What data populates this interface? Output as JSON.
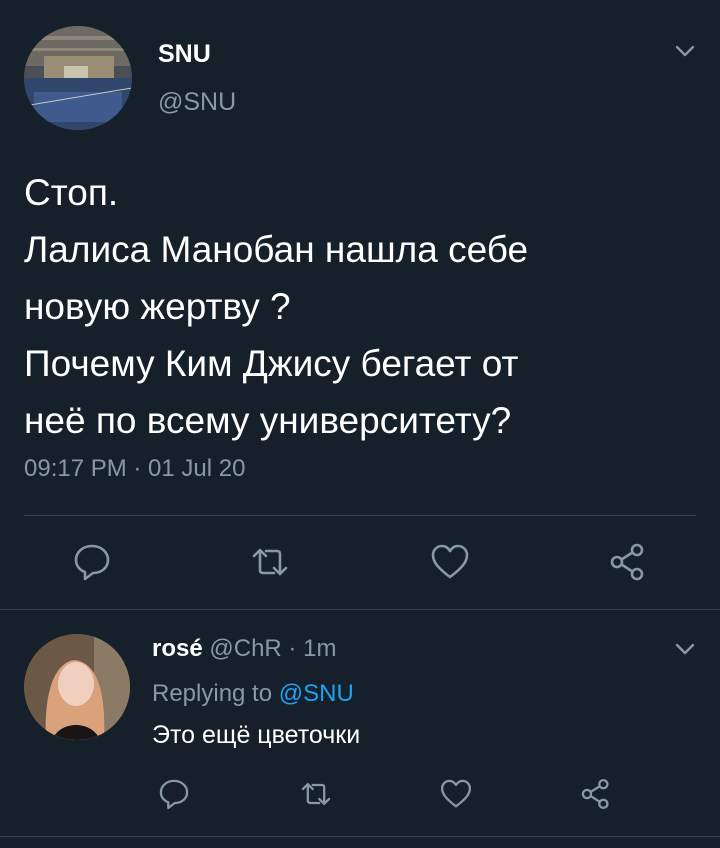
{
  "main_tweet": {
    "display_name": "SNU",
    "handle": "@SNU",
    "text_lines": [
      "Стоп.",
      "Лалиса Манобан нашла себе",
      "новую жертву ?",
      "Почему Ким Джису бегает от",
      "неё по всему университету?"
    ],
    "timestamp": "09:17 PM · 01 Jul 20",
    "actions": [
      "reply-icon",
      "retweet-icon",
      "like-icon",
      "share-icon"
    ]
  },
  "reply": {
    "display_name": "rosé",
    "handle": "@ChR",
    "separator": "·",
    "time": "1m",
    "replying_prefix": "Replying to",
    "replying_to": "@SNU",
    "text": "Это ещё цветочки",
    "actions": [
      "reply-icon",
      "retweet-icon",
      "like-icon",
      "share-icon"
    ]
  },
  "colors": {
    "background": "#15202b",
    "text": "#ffffff",
    "secondary": "#8899a6",
    "accent": "#1da1f2",
    "divider": "#38444d"
  }
}
